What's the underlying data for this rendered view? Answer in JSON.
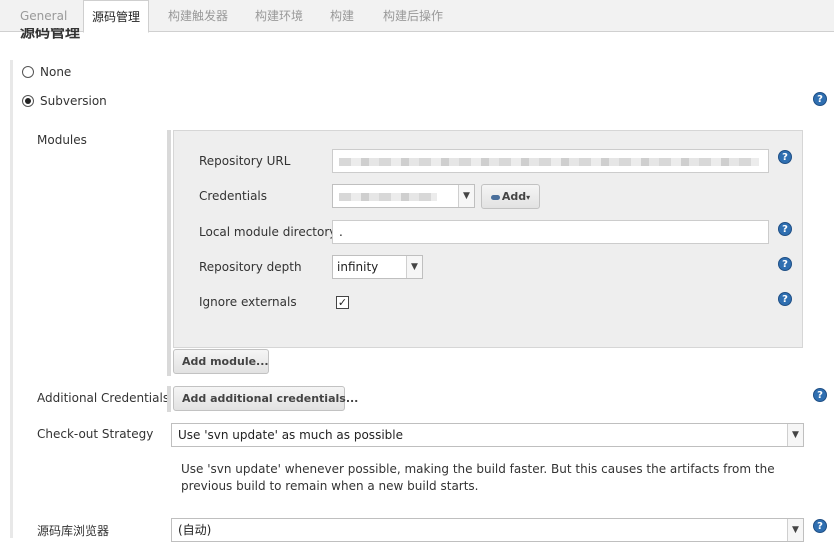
{
  "tabs": [
    "General",
    "源码管理",
    "构建触发器",
    "构建环境",
    "构建",
    "构建后操作"
  ],
  "section_title": "源码管理",
  "scm": {
    "none_label": "None",
    "subversion_label": "Subversion",
    "selected": "Subversion"
  },
  "modules": {
    "label": "Modules",
    "repository_url_label": "Repository URL",
    "repository_url_value": "",
    "credentials_label": "Credentials",
    "credentials_value": "",
    "add_button": "Add",
    "local_dir_label": "Local module directory",
    "local_dir_value": ".",
    "depth_label": "Repository depth",
    "depth_value": "infinity",
    "ignore_externals_label": "Ignore externals",
    "ignore_externals_checked": true,
    "add_module_button": "Add module..."
  },
  "additional_credentials": {
    "label": "Additional Credentials",
    "button": "Add additional credentials..."
  },
  "checkout": {
    "label": "Check-out Strategy",
    "value": "Use 'svn update' as much as possible",
    "description": "Use 'svn update' whenever possible, making the build faster. But this causes the artifacts from the previous build to remain when a new build starts."
  },
  "browser": {
    "label": "源码库浏览器",
    "value": "(自动)"
  },
  "help_icon_glyph": "?",
  "checkbox_glyph": "✓",
  "caret_glyph": "▼",
  "colors": {
    "help_icon": "#2f6fb1",
    "active_tab_bg": "#ffffff",
    "tabbar_bg": "#f2f2f2",
    "module_box_bg": "#eeeeee"
  }
}
